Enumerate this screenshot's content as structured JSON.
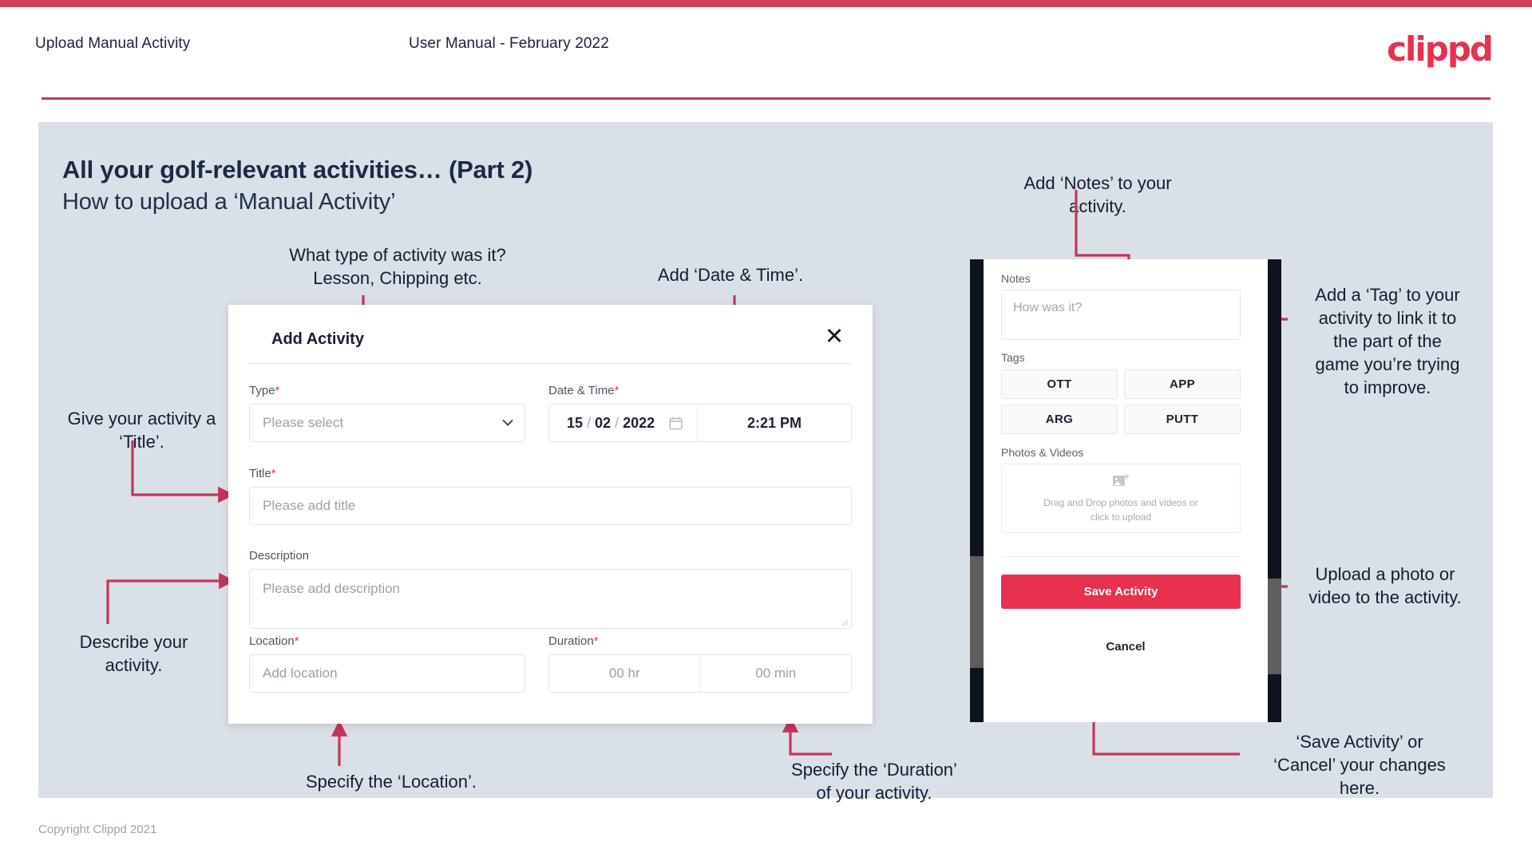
{
  "header": {
    "left_title": "Upload Manual Activity",
    "center_title": "User Manual - February 2022",
    "logo": "clippd",
    "accent_color": "#e8314f",
    "stripe_color": "#d1405c"
  },
  "slide": {
    "heading": "All your golf-relevant activities… (Part 2)",
    "subheading": "How to upload a ‘Manual Activity’",
    "background_color": "#dae0e7"
  },
  "annotations": {
    "type_note": "What type of activity was it?\nLesson, Chipping etc.",
    "datetime_note": "Add ‘Date & Time’.",
    "notes_note": "Add ‘Notes’ to your\nactivity.",
    "tag_note": "Add a ‘Tag’ to your\nactivity to link it to\nthe part of the\ngame you’re trying\nto improve.",
    "title_note": "Give your activity a\n‘Title’.",
    "description_note": "Describe your\nactivity.",
    "location_note": "Specify the ‘Location’.",
    "duration_note": "Specify the ‘Duration’\nof your activity.",
    "photo_note": "Upload a photo or\nvideo to the activity.",
    "save_note": "‘Save Activity’ or\n‘Cancel’ your changes\nhere."
  },
  "dialog": {
    "title": "Add Activity",
    "close_icon": "close-icon",
    "fields": {
      "type": {
        "label": "Type",
        "required": "*",
        "placeholder": "Please select",
        "chevron_icon": "chevron-down-icon"
      },
      "datetime": {
        "label": "Date & Time",
        "required": "*",
        "day": "15",
        "month": "02",
        "year": "2022",
        "separator": "/",
        "calendar_icon": "calendar-icon",
        "time": "2:21 PM"
      },
      "title": {
        "label": "Title",
        "required": "*",
        "placeholder": "Please add title"
      },
      "description": {
        "label": "Description",
        "required": "",
        "placeholder": "Please add description"
      },
      "location": {
        "label": "Location",
        "required": "*",
        "placeholder": "Add location"
      },
      "duration": {
        "label": "Duration",
        "required": "*",
        "hours_placeholder": "00 hr",
        "minutes_placeholder": "00 min"
      }
    }
  },
  "phone": {
    "notes": {
      "label": "Notes",
      "placeholder": "How was it?"
    },
    "tags": {
      "label": "Tags",
      "options": [
        "OTT",
        "APP",
        "ARG",
        "PUTT"
      ]
    },
    "photos": {
      "label": "Photos & Videos",
      "upload_icon": "add-image-icon",
      "drop_text_line1": "Drag and Drop photos and videos or",
      "drop_text_line2": "click to upload"
    },
    "save_label": "Save Activity",
    "cancel_label": "Cancel",
    "save_color": "#e8314f"
  },
  "footer": {
    "copyright": "Copyright Clippd 2021"
  }
}
